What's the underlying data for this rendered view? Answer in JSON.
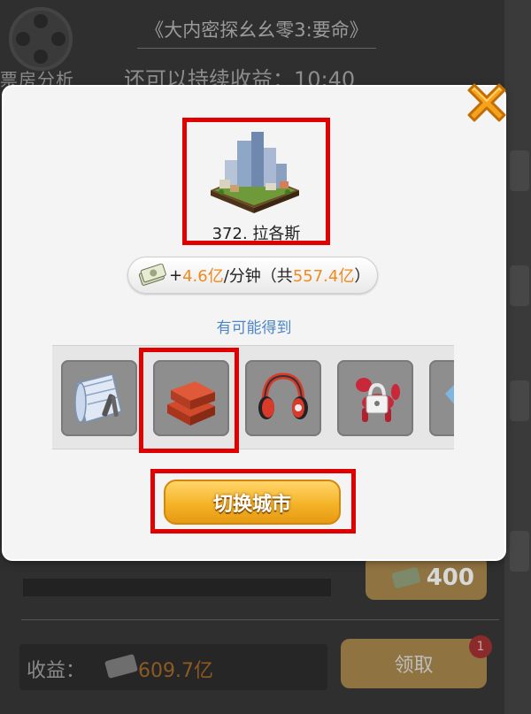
{
  "background": {
    "movie_title": "《大内密探幺幺零3:要命》",
    "box_office_label": "票房分析",
    "duration_text": "还可以持续收益：10:40",
    "ticket_count": "400",
    "income_label": "收益：",
    "income_value": "609.7亿",
    "claim_label": "领取",
    "badge_count": "1"
  },
  "dialog": {
    "city": {
      "name": "372. 拉各斯",
      "icon": "city-skyline-icon"
    },
    "income": {
      "prefix": "+",
      "rate": "4.6亿",
      "mid": "/分钟（共",
      "total": "557.4亿",
      "suffix": "）"
    },
    "maybe_get_label": "有可能得到",
    "rewards": [
      {
        "name": "blueprint-icon"
      },
      {
        "name": "bricks-icon"
      },
      {
        "name": "headphones-icon"
      },
      {
        "name": "locked-balloon-dog-icon"
      },
      {
        "name": "gem-icon"
      }
    ],
    "switch_city_label": "切换城市",
    "close_icon": "close-icon"
  },
  "colors": {
    "highlight": "#e00000",
    "accent_orange": "#f08a1e",
    "link_blue": "#4d86c5",
    "button_gold": "#f5b328"
  }
}
